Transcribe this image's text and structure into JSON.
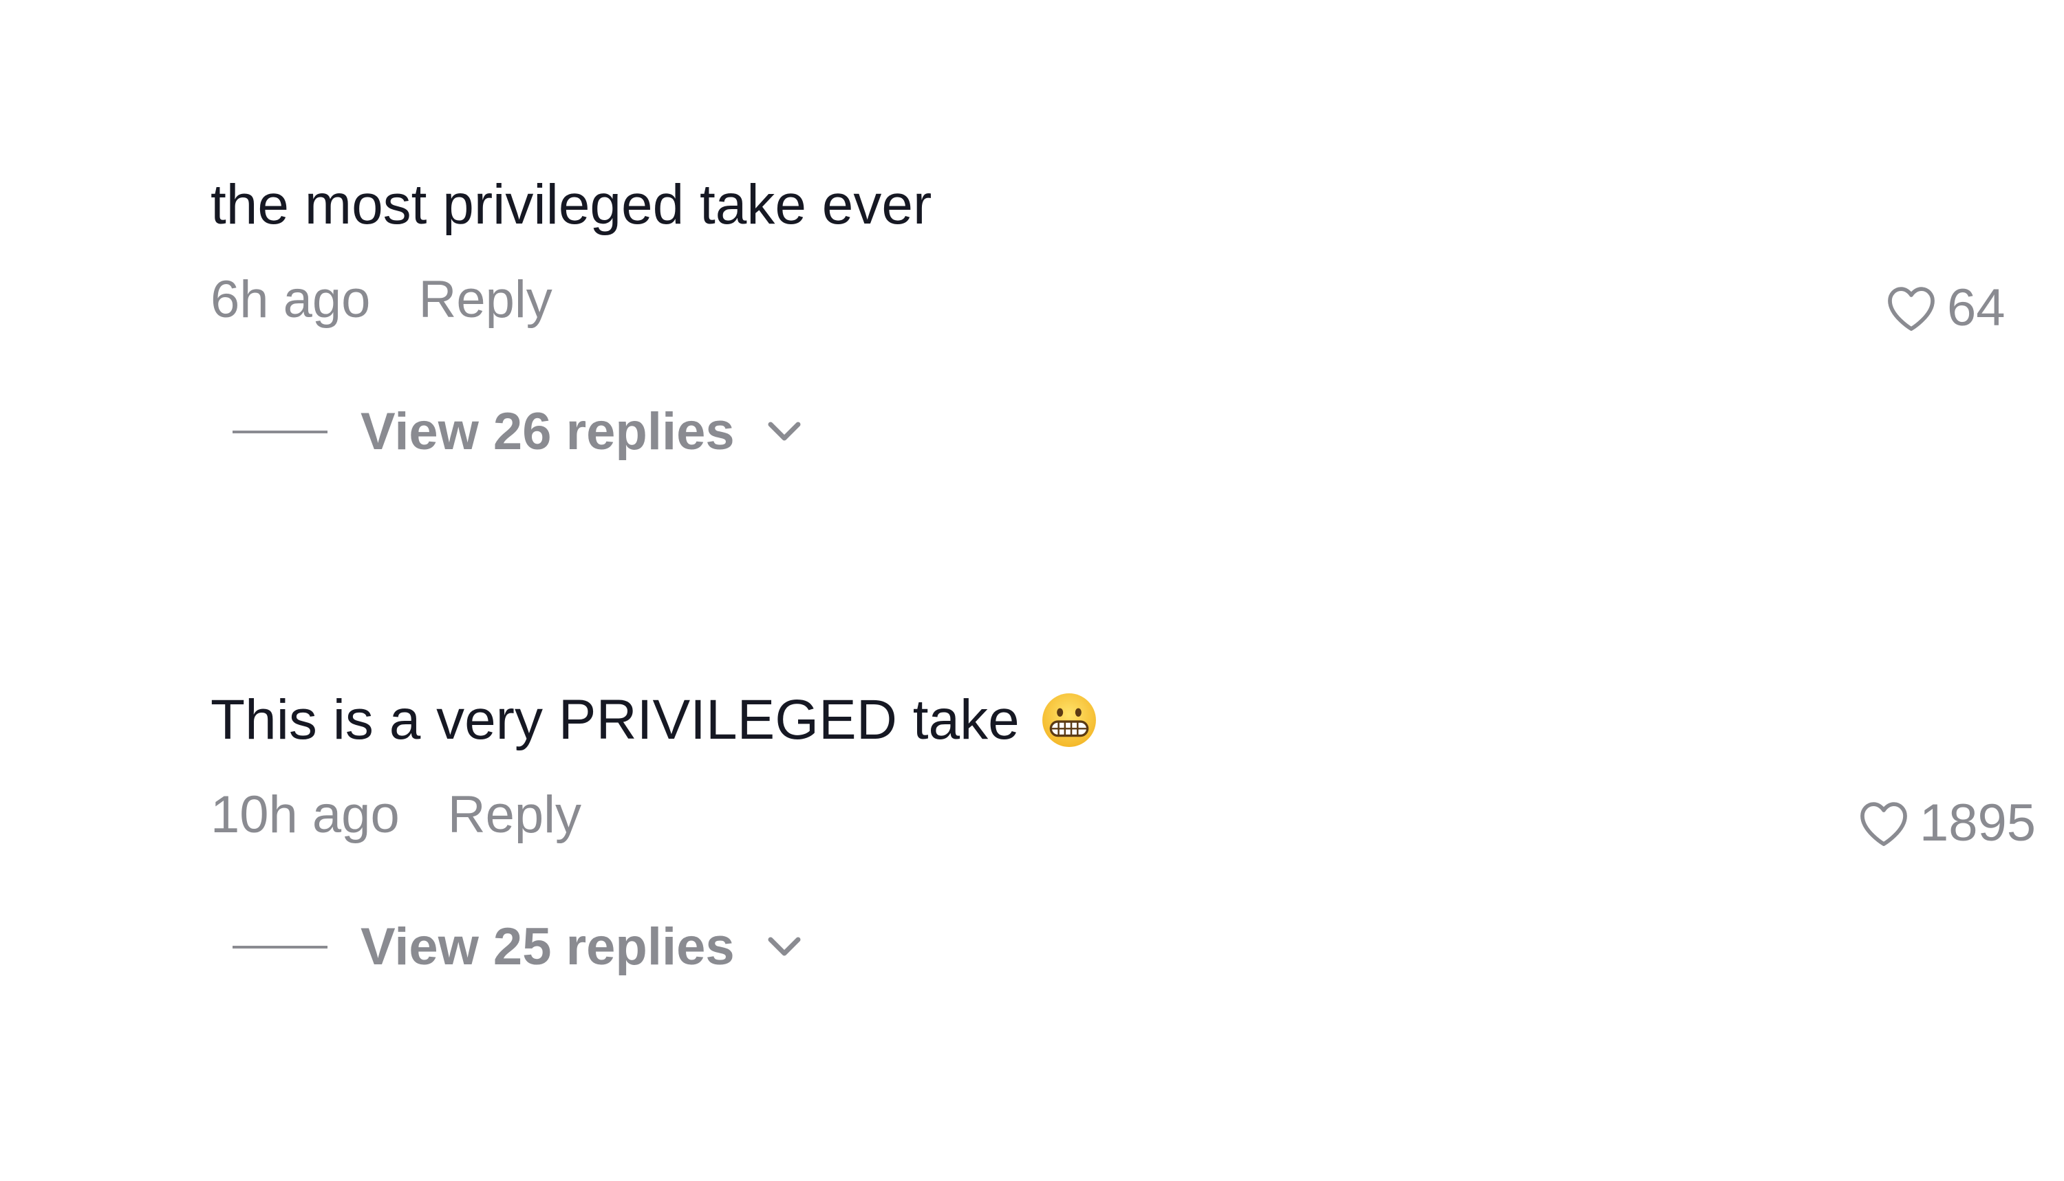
{
  "comments": [
    {
      "text": "the most privileged take ever",
      "timestamp": "6h ago",
      "reply_label": "Reply",
      "likes": "64",
      "view_replies_label": "View 26 replies"
    },
    {
      "text": "This is a very PRIVILEGED take",
      "emoji_icon": "grimacing-face-icon",
      "timestamp": "10h ago",
      "reply_label": "Reply",
      "likes": "1895",
      "view_replies_label": "View 25 replies"
    }
  ],
  "colors": {
    "text_primary": "#161823",
    "text_secondary": "#8a8b91",
    "background": "#ffffff"
  }
}
